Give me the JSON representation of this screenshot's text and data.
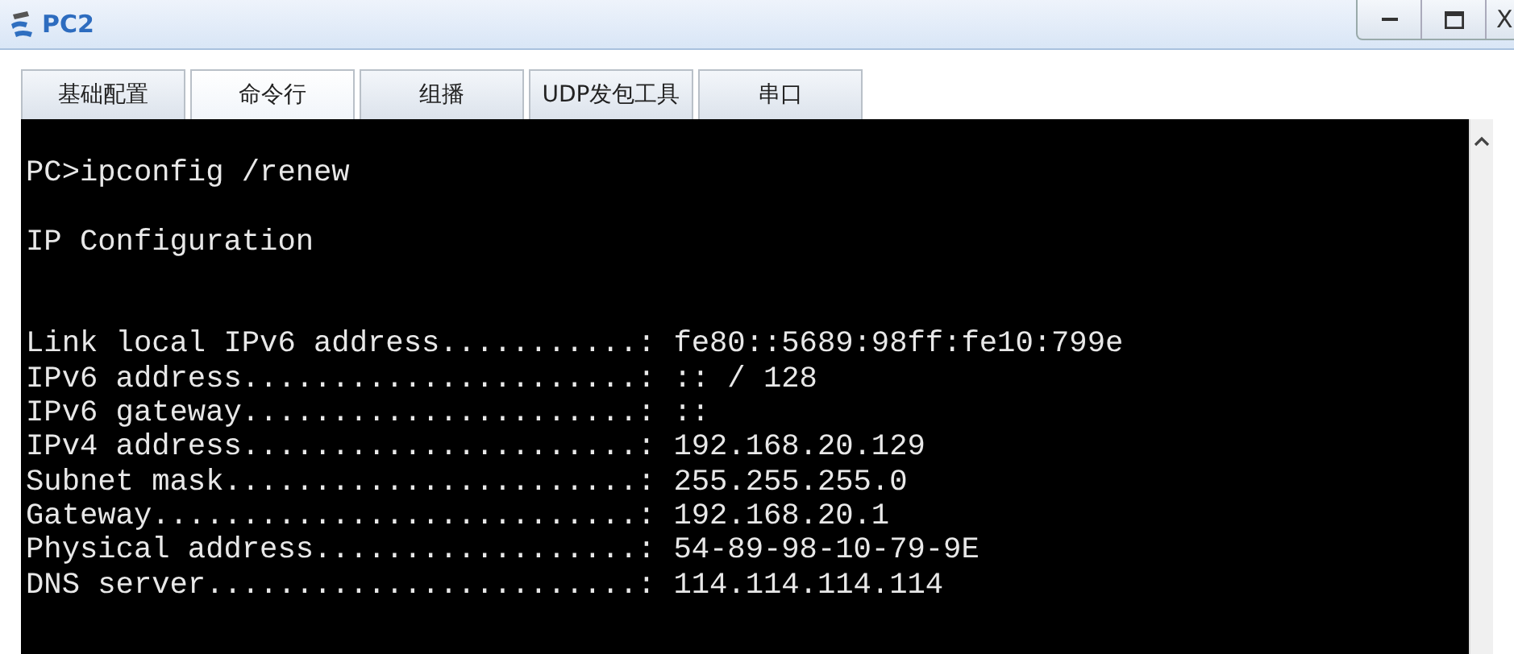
{
  "window": {
    "title": "PC2",
    "controls": [
      {
        "kind": "minimize"
      },
      {
        "kind": "maximize"
      },
      {
        "kind": "close",
        "label": "X"
      }
    ]
  },
  "tabs": [
    {
      "label": "基础配置",
      "selected": false
    },
    {
      "label": "命令行",
      "selected": true
    },
    {
      "label": "组播",
      "selected": false
    },
    {
      "label": "UDP发包工具",
      "selected": false
    },
    {
      "label": "串口",
      "selected": false
    }
  ],
  "console": {
    "blocks": [
      [
        "PC>ipconfig /renew"
      ],
      [
        "IP Configuration"
      ],
      [
        "Link local IPv6 address...........: fe80::5689:98ff:fe10:799e",
        "IPv6 address......................: :: / 128",
        "IPv6 gateway......................: ::",
        "IPv4 address......................: 192.168.20.129",
        "Subnet mask.......................: 255.255.255.0",
        "Gateway...........................: 192.168.20.1",
        "Physical address..................: 54-89-98-10-79-9E",
        "DNS server........................: 114.114.114.114"
      ]
    ]
  }
}
